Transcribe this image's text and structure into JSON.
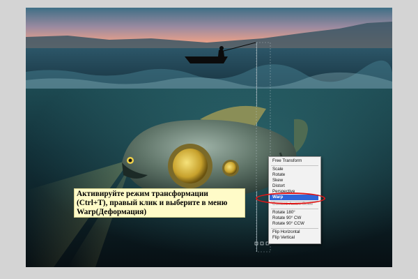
{
  "context_menu": {
    "items": [
      {
        "label": "Free Transform",
        "state": "normal"
      },
      {
        "label": "Scale",
        "state": "normal"
      },
      {
        "label": "Rotate",
        "state": "normal"
      },
      {
        "label": "Skew",
        "state": "normal"
      },
      {
        "label": "Distort",
        "state": "normal"
      },
      {
        "label": "Perspective",
        "state": "normal"
      },
      {
        "label": "Warp",
        "state": "highlighted"
      },
      {
        "label": "Content-Aware Scale",
        "state": "disabled"
      },
      {
        "label": "Rotate 180°",
        "state": "normal"
      },
      {
        "label": "Rotate 90° CW",
        "state": "normal"
      },
      {
        "label": "Rotate 90° CCW",
        "state": "normal"
      },
      {
        "label": "Flip Horizontal",
        "state": "normal"
      },
      {
        "label": "Flip Vertical",
        "state": "normal"
      }
    ]
  },
  "caption": {
    "line1": "Активируйте режим трансформации",
    "line2": "(Ctrl+T), правый клик и выберите в меню",
    "line3": "Warp(Деформация)"
  },
  "colors": {
    "menu_highlight": "#2f66d8",
    "caption_background": "#fffbc8",
    "annotation_ring": "#e01616"
  }
}
